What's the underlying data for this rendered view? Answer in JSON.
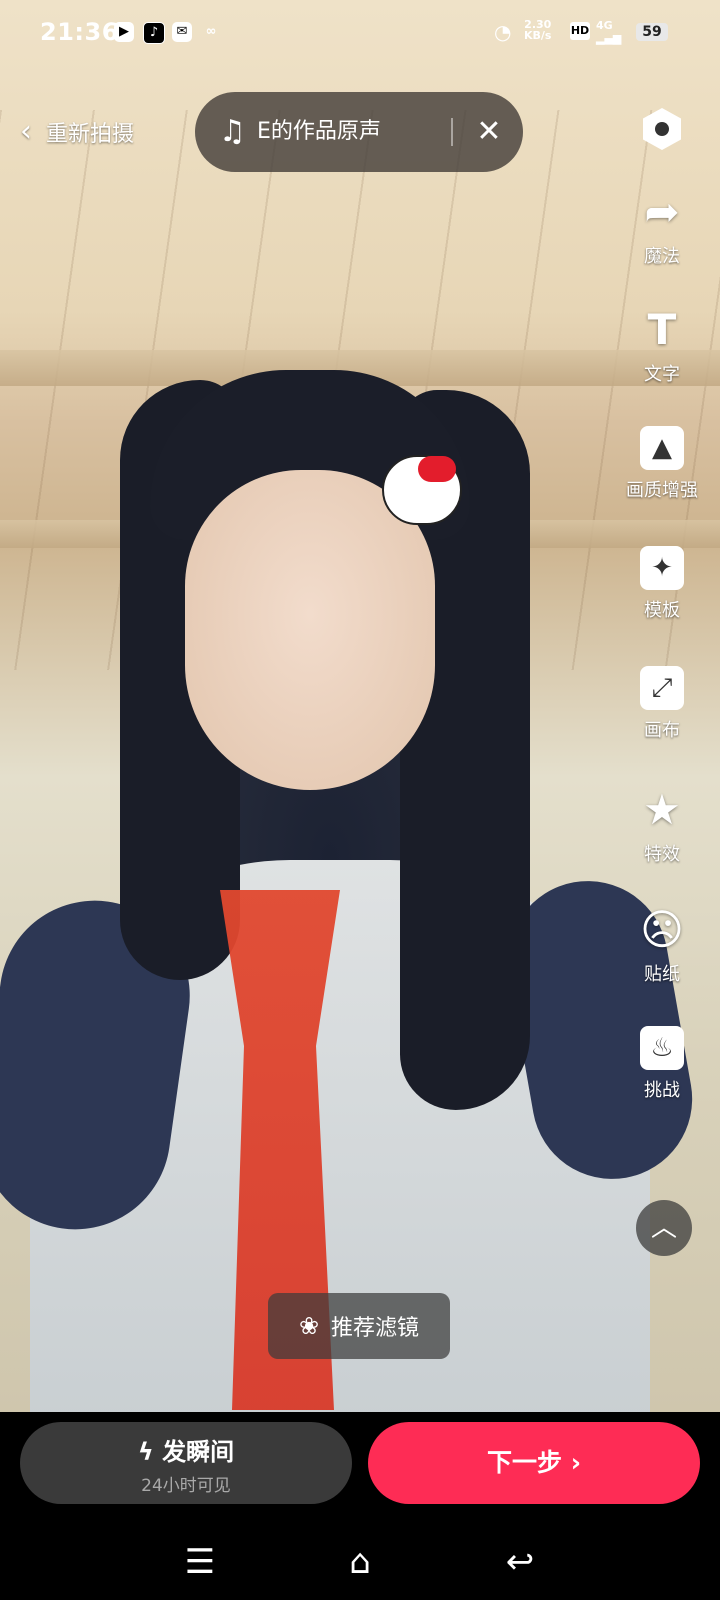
{
  "status_bar": {
    "time": "21:36",
    "network_speed": "2.30",
    "network_unit": "KB/s",
    "hd": "HD",
    "signal": "4G",
    "battery": "59",
    "app_icons": [
      "video-icon",
      "tiktok-icon",
      "mail-icon",
      "link-icon"
    ]
  },
  "header": {
    "reshoot_label": "重新拍摄",
    "music_title": "E的作品原声"
  },
  "tools": [
    {
      "id": "settings",
      "label": ""
    },
    {
      "id": "magic",
      "label": "魔法"
    },
    {
      "id": "text",
      "label": "文字"
    },
    {
      "id": "enhance",
      "label": "画质增强"
    },
    {
      "id": "template",
      "label": "模板"
    },
    {
      "id": "canvas",
      "label": "画布"
    },
    {
      "id": "effects",
      "label": "特效"
    },
    {
      "id": "stickers",
      "label": "贴纸"
    },
    {
      "id": "challenge",
      "label": "挑战"
    }
  ],
  "filter_label": "推荐滤镜",
  "bottom": {
    "moment_label": "发瞬间",
    "moment_sub": "24小时可见",
    "next_label": "下一步"
  },
  "colors": {
    "accent": "#fe2c55",
    "moment_bg": "#3a3a3a"
  }
}
